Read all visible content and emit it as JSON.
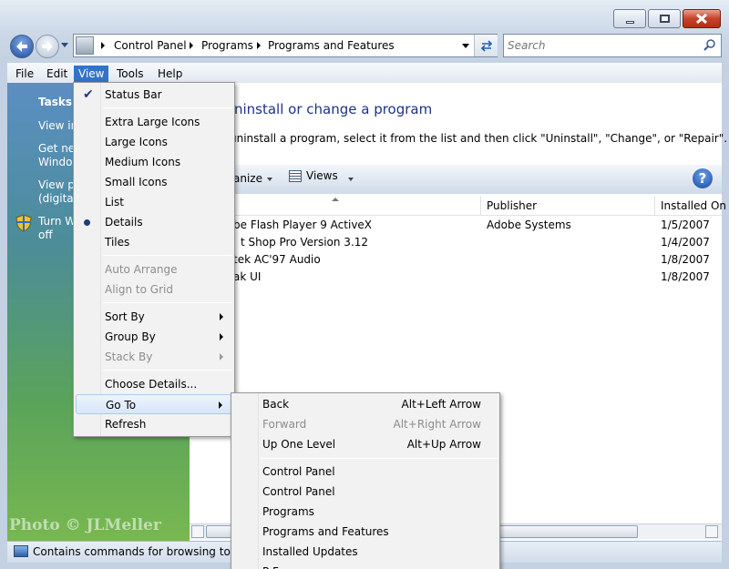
{
  "address": {
    "crumbs": [
      "Control Panel",
      "Programs",
      "Programs and Features"
    ]
  },
  "search": {
    "placeholder": "Search"
  },
  "menubar": [
    "File",
    "Edit",
    "View",
    "Tools",
    "Help"
  ],
  "tasks": {
    "heading": "Tasks",
    "items": [
      "View in",
      "Get new",
      "Window",
      "View pu",
      "(digital",
      "Turn W",
      "off"
    ]
  },
  "page": {
    "title": "Uninstall or change a program",
    "instruction": "uninstall a program, select it from the list and then click \"Uninstall\", \"Change\", or \"Repair\"."
  },
  "toolbar": {
    "organize": "anize",
    "views": "Views"
  },
  "columns": [
    "Publisher",
    "Installed On"
  ],
  "programs": [
    {
      "name": "be Flash Player 9 ActiveX",
      "publisher": "Adobe Systems",
      "installed": "1/5/2007"
    },
    {
      "name": "t Shop Pro Version 3.12",
      "publisher": "",
      "installed": "1/4/2007"
    },
    {
      "name": "tek AC'97 Audio",
      "publisher": "",
      "installed": "1/8/2007"
    },
    {
      "name": "ak UI",
      "publisher": "",
      "installed": "1/8/2007"
    }
  ],
  "view_menu": {
    "status_bar": "Status Bar",
    "extra_large_icons": "Extra Large Icons",
    "large_icons": "Large Icons",
    "medium_icons": "Medium Icons",
    "small_icons": "Small Icons",
    "list": "List",
    "details": "Details",
    "tiles": "Tiles",
    "auto_arrange": "Auto Arrange",
    "align_to_grid": "Align to Grid",
    "sort_by": "Sort By",
    "group_by": "Group By",
    "stack_by": "Stack By",
    "choose_details": "Choose Details...",
    "go_to": "Go To",
    "refresh": "Refresh"
  },
  "goto_menu": {
    "back": "Back",
    "back_key": "Alt+Left Arrow",
    "forward": "Forward",
    "forward_key": "Alt+Right Arrow",
    "up": "Up One Level",
    "up_key": "Alt+Up Arrow",
    "cp1": "Control Panel",
    "cp2": "Control Panel",
    "programs": "Programs",
    "paf": "Programs and Features",
    "updates": "Installed Updates",
    "partial": "P                  F"
  },
  "status": {
    "text": "Contains commands for browsing to vari"
  },
  "watermark": "Photo © JLMeller",
  "colors": {
    "accent": "#2c5aa0",
    "highlight": "#3399ff",
    "title_text": "#1e3287"
  }
}
